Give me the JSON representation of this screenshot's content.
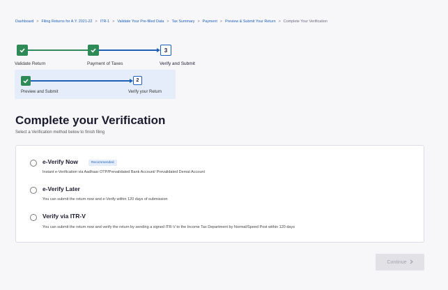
{
  "breadcrumb": {
    "items": [
      "Dashboard",
      "Filing Returns for A.Y. 2021-22",
      "ITR-1",
      "Validate Your Pre-filled Data",
      "Tax Summary",
      "Payment",
      "Preview & Submit Your Return"
    ],
    "current": "Complete Your Verification",
    "separator": ">"
  },
  "stepper": {
    "steps": [
      {
        "label": "Validate Return",
        "state": "done"
      },
      {
        "label": "Payment of Taxes",
        "state": "done"
      },
      {
        "label": "Verify and Submit",
        "state": "active",
        "number": "3"
      }
    ]
  },
  "substepper": {
    "steps": [
      {
        "label": "Preview and Submit",
        "state": "done"
      },
      {
        "label": "Verify your Return",
        "state": "active",
        "number": "2"
      }
    ]
  },
  "page": {
    "title": "Complete your Verification",
    "subtitle": "Select a Verification method below to finish filing"
  },
  "options": [
    {
      "title": "e-Verify Now",
      "badge": "Recommended",
      "description": "Instant e-Verification via Aadhaar OTP/Prevalidated Bank Account/ Prevalidated Demat Account",
      "selected": false
    },
    {
      "title": "e-Verify Later",
      "description": "You can submit the return now and e-Verify within 120 days of submission",
      "selected": false
    },
    {
      "title": "Verify via ITR-V",
      "description": "You can submit the return now and verify the return by sending a signed ITR-V to the Income Tax Department by Normal/Speed Post within 120 days",
      "selected": false
    }
  ],
  "actions": {
    "continue_label": "Continue",
    "continue_icon": "chevron-right-icon",
    "continue_enabled": false
  },
  "colors": {
    "accent": "#1d5fb8",
    "success": "#2e8b57",
    "substep_bg": "#e4edf9",
    "disabled_bg": "#e1e1e6"
  }
}
